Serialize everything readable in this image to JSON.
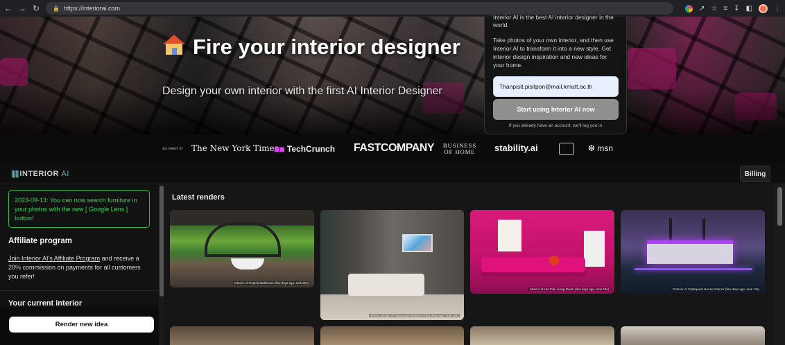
{
  "browser": {
    "url": "https://interiorai.com"
  },
  "hero": {
    "title": "Fire your interior designer",
    "subtitle": "Design your own interior with the first AI Interior Designer"
  },
  "signup": {
    "cut_text": "Interior AI is the best AI interior designer in the world.",
    "description": "Take photos of your own interior, and then use Interior AI to transform it into a new style. Get interior design inspiration and new ideas for your home.",
    "email_value": "Thanpisit.pisitpon@mail.kmutt.ac.th",
    "start_label": "Start using Interior AI now",
    "note": "If you already have an account, we'll log you in"
  },
  "press": {
    "seen_in": "as seen in",
    "logos": [
      "The New York Times",
      "TechCrunch",
      "FASTCOMPANY",
      "BUSINESS OF HOME",
      "stability.ai",
      "msn"
    ]
  },
  "appbar": {
    "brand": "INTERIOR",
    "brand_ai": "AI",
    "billing_label": "Billing"
  },
  "sidebar": {
    "notice": "2023-09-13: You can now search furniture in your photos with the new [ Google Lens ] button!",
    "affiliate_title": "Affiliate program",
    "affiliate_link": "Join Interior AI's Affiliate Program",
    "affiliate_rest": " and receive a 20% commission on payments for all customers you refer!",
    "current_title": "Your current interior",
    "render_label": "Render new idea"
  },
  "main": {
    "latest_title": "Latest renders",
    "renders": [
      {
        "caption": "Interior of Tropical Bathroom (few days ago, took 20s)"
      },
      {
        "caption": "Interior Design of Vaporwave Bedroom (few days ago, took 10s)"
      },
      {
        "caption": "Interior of Hot Pink Living Room (few days ago, took 20s)"
      },
      {
        "caption": "Exterior of Cyberpunk House Exterior (few days ago, took 14s)"
      }
    ]
  },
  "colors": {
    "accent_green": "#2fbf4a",
    "brand_teal": "#4bb7c9",
    "hot_pink": "#d81b7a"
  }
}
